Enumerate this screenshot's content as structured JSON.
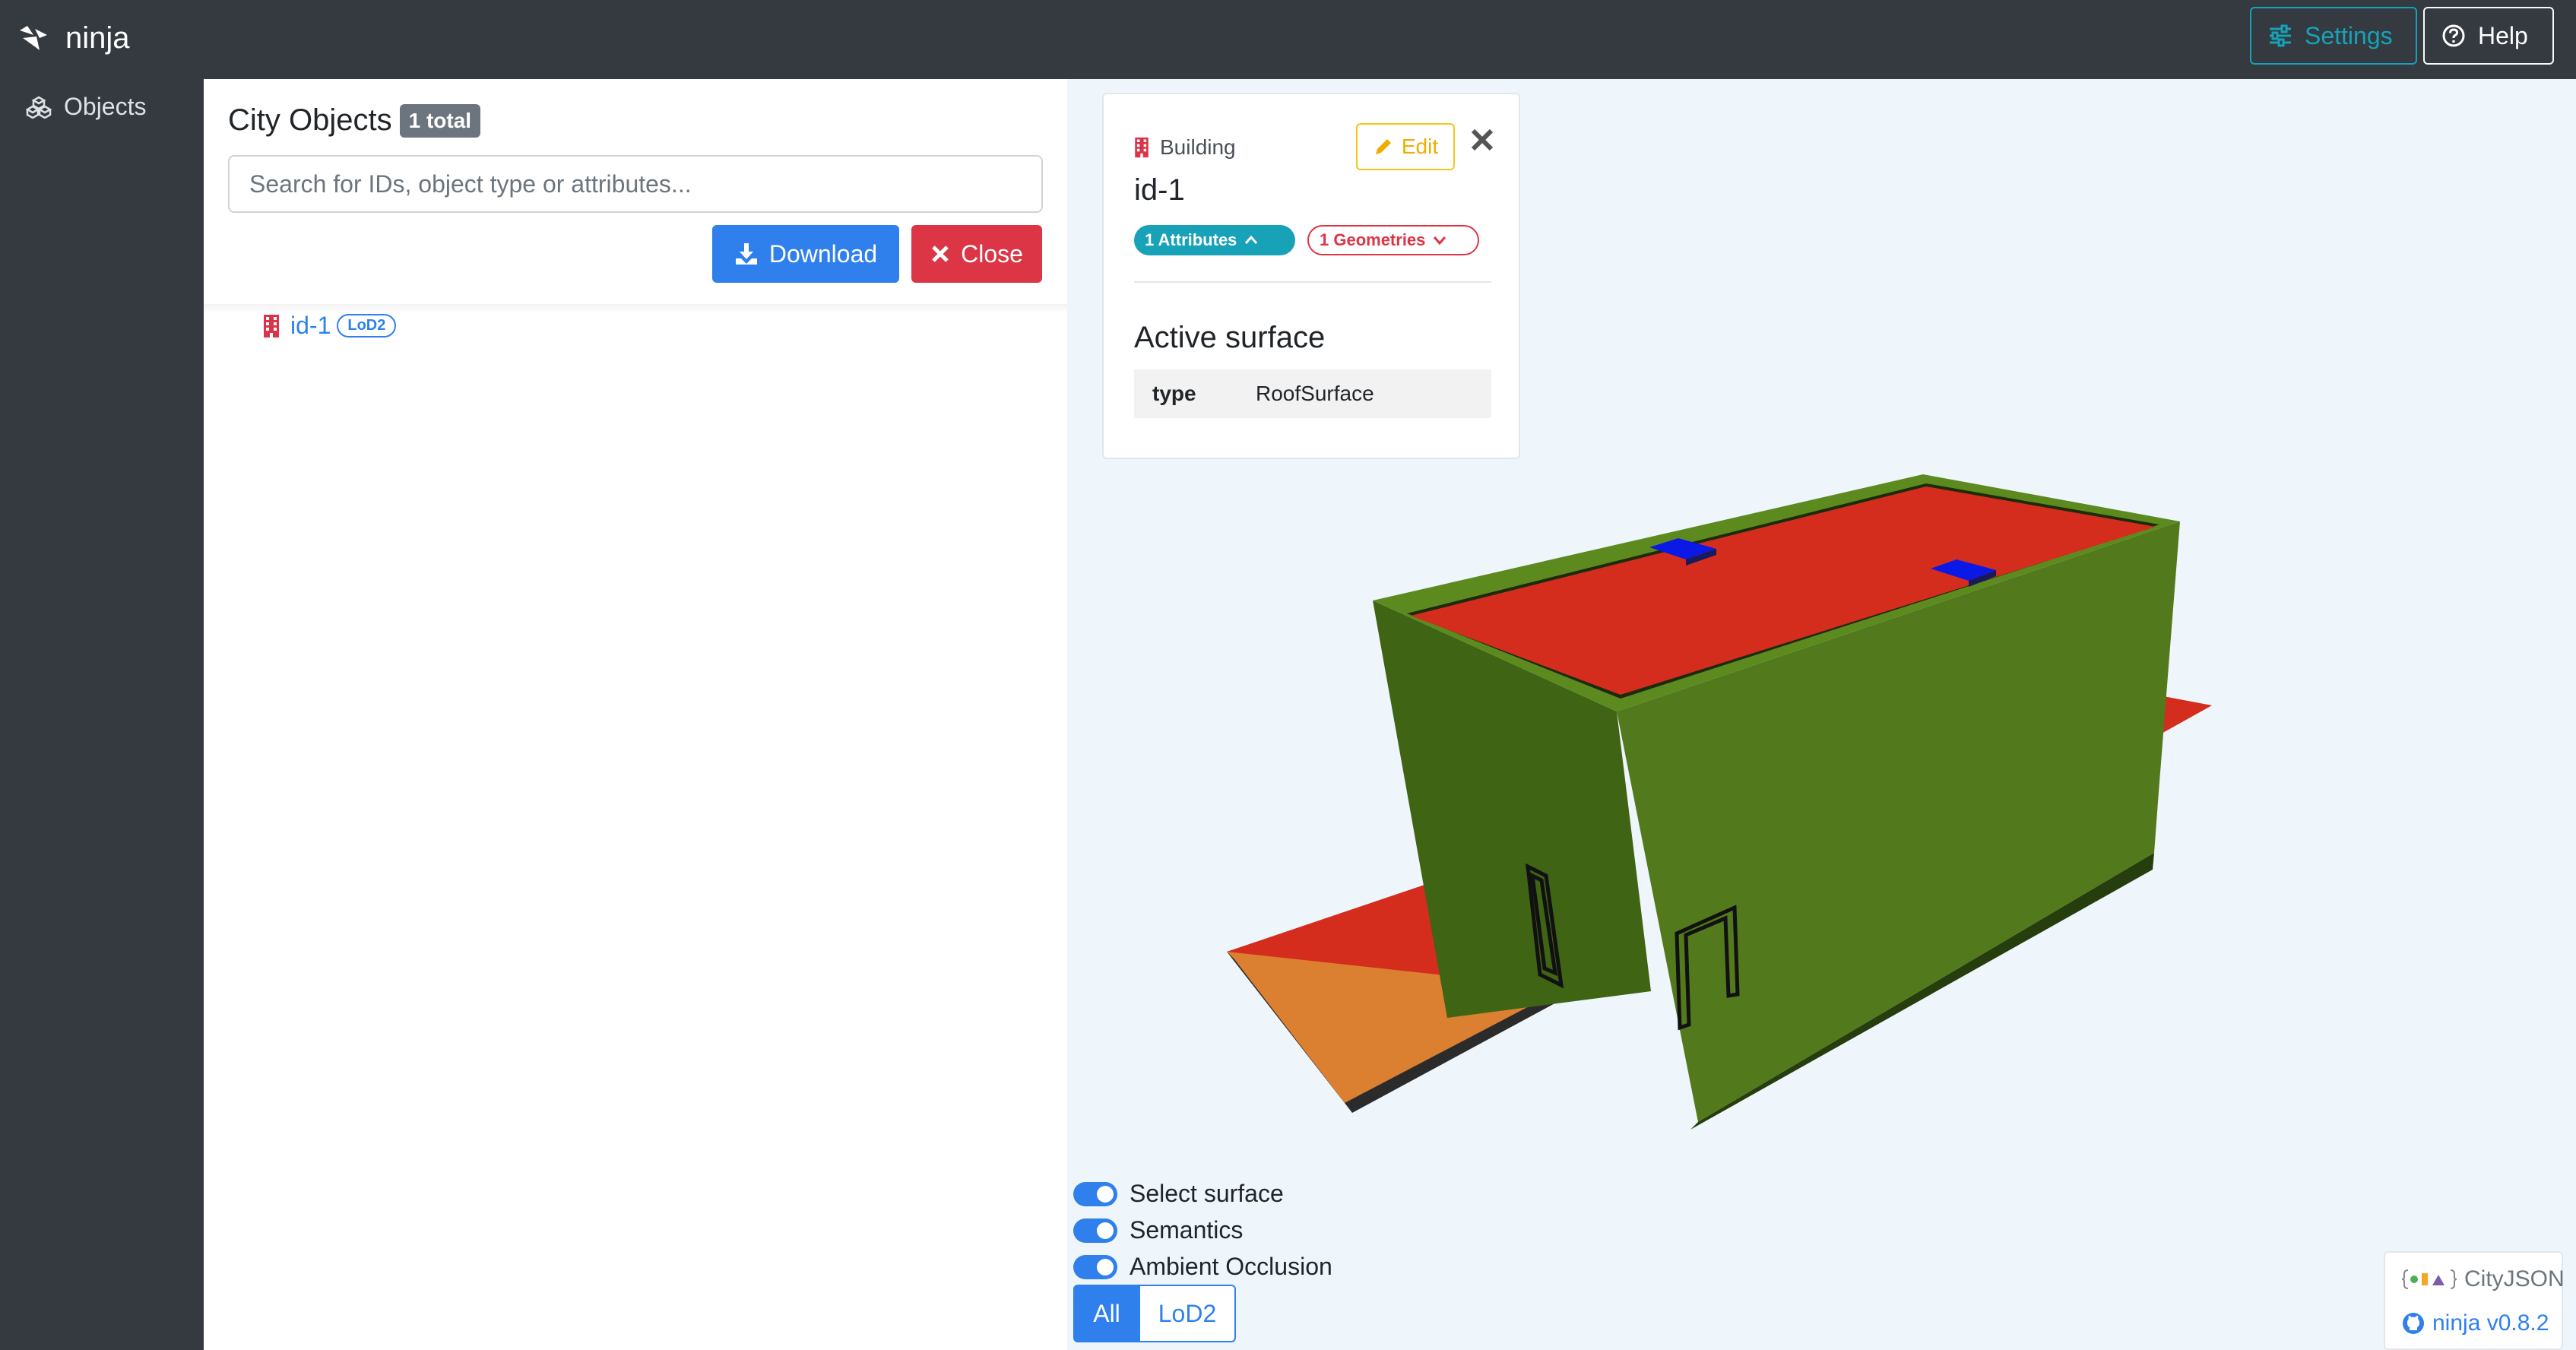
{
  "app": {
    "brand": "ninja"
  },
  "header": {
    "settings_label": "Settings",
    "help_label": "Help"
  },
  "sidebar": {
    "items": [
      {
        "label": "Objects"
      }
    ]
  },
  "objects_panel": {
    "title": "City Objects",
    "count_badge": "1 total",
    "search_placeholder": "Search for IDs, object type or attributes...",
    "download_label": "Download",
    "close_label": "Close",
    "items": [
      {
        "id": "id-1",
        "lod": "LoD2"
      }
    ]
  },
  "info_card": {
    "object_type": "Building",
    "object_id": "id-1",
    "edit_label": "Edit",
    "attributes_pill": "1 Attributes",
    "geometries_pill": "1 Geometries",
    "section_title": "Active surface",
    "attributes": [
      {
        "key": "type",
        "value": "RoofSurface"
      }
    ]
  },
  "viewer_controls": {
    "toggles": [
      {
        "label": "Select surface",
        "on": true
      },
      {
        "label": "Semantics",
        "on": true
      },
      {
        "label": "Ambient Occlusion",
        "on": true
      }
    ],
    "lod_buttons": [
      {
        "label": "All",
        "active": true
      },
      {
        "label": "LoD2",
        "active": false
      }
    ]
  },
  "credits": {
    "format_label": "CityJSON",
    "version_label": "ninja v0.8.2"
  },
  "colors": {
    "primary": "#2f80ed",
    "info": "#17a2b8",
    "danger": "#dc3545",
    "warning": "#f5c518",
    "roof": "#d42d1e",
    "wall": "#527a1c",
    "window": "#0a19e6",
    "ground": "#db8030",
    "navbar": "#343a40"
  }
}
